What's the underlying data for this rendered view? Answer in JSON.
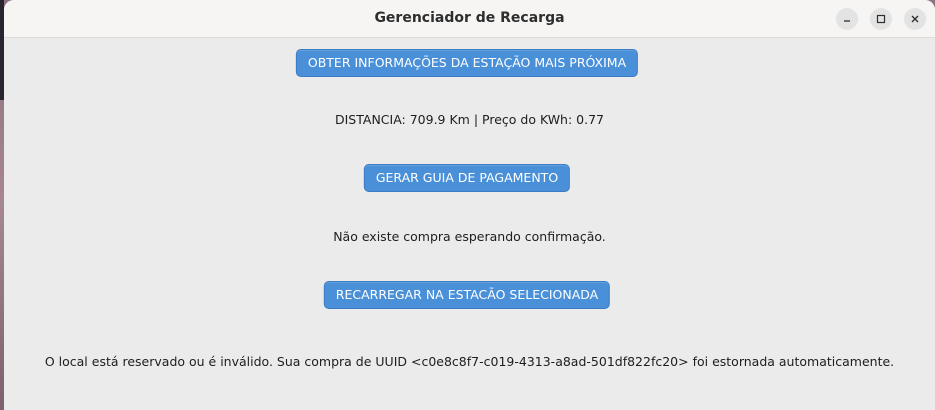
{
  "window": {
    "title": "Gerenciador de Recarga",
    "controls": {
      "minimize_icon": "minimize-icon",
      "maximize_icon": "maximize-icon",
      "close_icon": "close-icon"
    }
  },
  "main": {
    "nearest_station_button": "OBTER INFORMAÇÕES DA ESTAÇÃO MAIS PRÓXIMA",
    "distance_label": "DISTANCIA: 709.9 Km | Preço do KWh: 0.77",
    "payment_button": "GERAR GUIA DE PAGAMENTO",
    "purchase_status": "Não existe compra esperando confirmação.",
    "recharge_button": "RECARREGAR NA ESTACÃO SELECIONADA",
    "refund_message": "O local está reservado ou é inválido. Sua compra de UUID <c0e8c8f7-c019-4313-a8ad-501df822fc20> foi estornada automaticamente."
  },
  "colors": {
    "button_bg": "#4a90d9",
    "button_text": "#ffffff",
    "window_bg": "#ebebeb",
    "titlebar_bg": "#f6f5f4"
  }
}
